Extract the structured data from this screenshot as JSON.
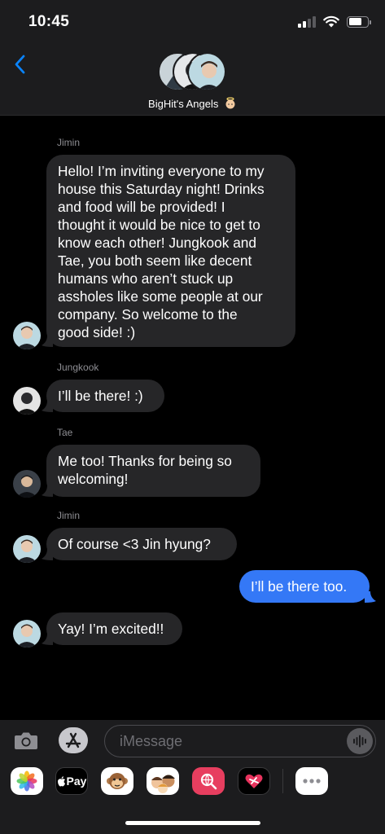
{
  "status_bar": {
    "time": "10:45"
  },
  "header": {
    "group_name": "BigHit's Angels",
    "back_icon": "chevron-left-icon"
  },
  "messages": [
    {
      "sender": "Jimin",
      "text": "Hello! I’m inviting everyone to my\nhouse this Saturday night! Drinks\nand food will be provided! I\nthought it would be nice to get to\nknow each other! Jungkook and\nTae, you both seem like decent\nhumans who aren’t stuck up\nassholes like some people at our\ncompany. So welcome to the\ngood side! :)"
    },
    {
      "sender": "Jungkook",
      "text": "I’ll be there! :)"
    },
    {
      "sender": "Tae",
      "text": "Me too! Thanks for being so\nwelcoming!"
    },
    {
      "sender": "Jimin",
      "text": "Of course <3 Jin hyung?"
    },
    {
      "sender": "",
      "text": "I’ll be there too."
    },
    {
      "sender": "",
      "text": "Yay! I’m excited!!"
    }
  ],
  "composer": {
    "placeholder": "iMessage"
  },
  "app_drawer": {
    "apple_pay_label": "Pay",
    "icons": [
      "photos-icon",
      "apple-pay-icon",
      "animoji-icon",
      "memoji-icon",
      "web-search-icon",
      "digital-touch-icon",
      "more-apps-icon"
    ]
  },
  "colors": {
    "sent_bubble": "#3478f6",
    "received_bubble": "#262628",
    "accent": "#0a84ff"
  }
}
